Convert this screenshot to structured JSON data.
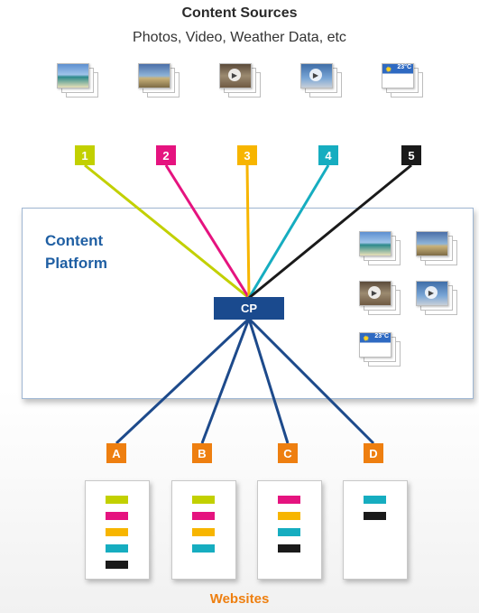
{
  "header": {
    "title": "Content Sources",
    "subtitle": "Photos, Video, Weather Data, etc"
  },
  "sources": [
    {
      "label": "1",
      "color": "#c2d000",
      "icon": "photo-stack-icon"
    },
    {
      "label": "2",
      "color": "#e5137f",
      "icon": "photo-stack-icon"
    },
    {
      "label": "3",
      "color": "#f7b500",
      "icon": "video-stack-icon"
    },
    {
      "label": "4",
      "color": "#16adc0",
      "icon": "video-stack-icon"
    },
    {
      "label": "5",
      "color": "#1a1a1a",
      "icon": "weather-stack-icon"
    }
  ],
  "weather_temp": "23°C",
  "platform": {
    "label_line1": "Content",
    "label_line2": "Platform",
    "hub_label": "CP",
    "hub_color": "#1a4a8e",
    "connector_color": "#1d4a8b"
  },
  "websites": [
    {
      "label": "A",
      "bars": [
        "#c2d000",
        "#e5137f",
        "#f7b500",
        "#16adc0",
        "#1a1a1a"
      ]
    },
    {
      "label": "B",
      "bars": [
        "#c2d000",
        "#e5137f",
        "#f7b500",
        "#16adc0"
      ]
    },
    {
      "label": "C",
      "bars": [
        "#e5137f",
        "#f7b500",
        "#16adc0",
        "#1a1a1a"
      ]
    },
    {
      "label": "D",
      "bars": [
        "#16adc0",
        "#1a1a1a"
      ]
    }
  ],
  "websites_label": "Websites",
  "accent_orange": "#ee7f10"
}
